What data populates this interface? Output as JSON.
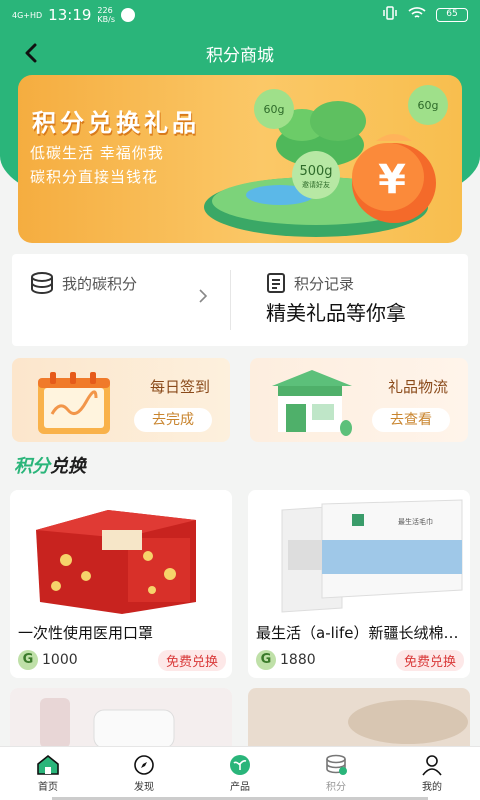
{
  "status_bar": {
    "network": "4G+HD",
    "time": "13:19",
    "speed_value": "226",
    "speed_unit": "KB/s",
    "battery": "65"
  },
  "header": {
    "title": "积分商城"
  },
  "banner": {
    "title": "积分兑换礼品",
    "subtitle_line1": "低碳生活 幸福你我",
    "subtitle_line2": "碳积分直接当钱花",
    "badge1": "60g",
    "badge2": "60g",
    "badge3": "500g",
    "badge3_sub": "邀请好友",
    "coin_symbol": "¥"
  },
  "points": {
    "my_points_label": "我的碳积分",
    "record_label": "积分记录",
    "record_desc": "精美礼品等你拿"
  },
  "actions": {
    "sign_label": "每日签到",
    "sign_button": "去完成",
    "logistics_label": "礼品物流",
    "logistics_button": "去查看"
  },
  "section": {
    "title_part1": "积分",
    "title_part2": "兑换"
  },
  "products": [
    {
      "name": "一次性使用医用口罩",
      "coin": "G",
      "price": "1000",
      "action": "免费兑换"
    },
    {
      "name": "最生活（a-life）新疆长绒棉毛巾",
      "coin": "G",
      "price": "1880",
      "action": "免费兑换"
    }
  ],
  "tabs": [
    {
      "label": "首页",
      "icon": "home-icon"
    },
    {
      "label": "发现",
      "icon": "compass-icon"
    },
    {
      "label": "产品",
      "icon": "sprout-icon"
    },
    {
      "label": "积分",
      "icon": "coins-icon"
    },
    {
      "label": "我的",
      "icon": "person-icon"
    }
  ],
  "colors": {
    "brand_green": "#2ab57a",
    "banner_orange": "#f5ad40",
    "redeem_red": "#d93a3a"
  }
}
